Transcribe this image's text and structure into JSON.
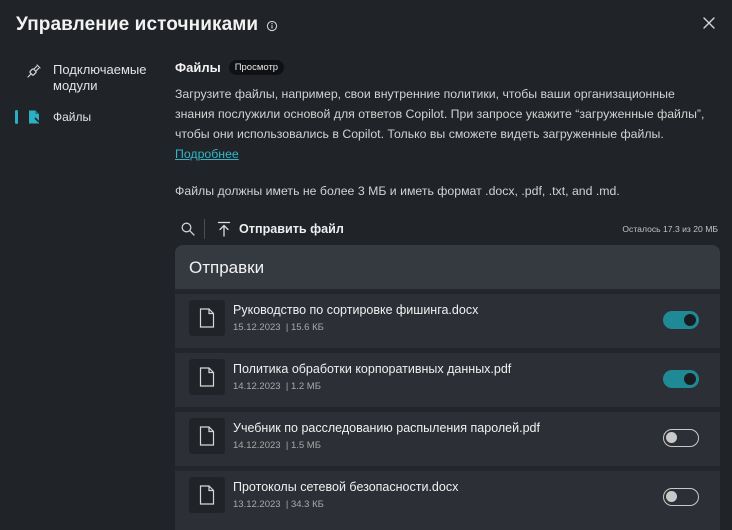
{
  "header": {
    "title": "Управление источниками"
  },
  "sidebar": {
    "items": [
      {
        "label": "Подключаемые модули",
        "icon": "plug-icon",
        "active": false
      },
      {
        "label": "Файлы",
        "icon": "file-icon",
        "active": true
      }
    ]
  },
  "files": {
    "title": "Файлы",
    "badge": "Просмотр",
    "description": "Загрузите файлы, например, свои внутренние политики, чтобы ваши организационные знания послужили основой для ответов Copilot. При запросе укажите “загруженные файлы”, чтобы они использовались в Copilot. Только вы сможете видеть загруженные файлы.",
    "learn_more": "Подробнее",
    "requirements": "Файлы должны иметь не более 3 МБ и иметь формат .docx, .pdf, .txt, and .md."
  },
  "toolbar": {
    "upload_label": "Отправить файл",
    "storage": "Осталось 17.3 из 20 МБ"
  },
  "uploads": {
    "title": "Отправки",
    "files": [
      {
        "name": "Руководство по сортировке фишинга.docx",
        "date": "15.12.2023",
        "size": "15.6 КБ",
        "enabled": true
      },
      {
        "name": "Политика обработки корпоративных данных.pdf",
        "date": "14.12.2023",
        "size": "1.2 МБ",
        "enabled": true
      },
      {
        "name": "Учебник по расследованию распыления паролей.pdf",
        "date": "14.12.2023",
        "size": "1.5 МБ",
        "enabled": false
      },
      {
        "name": "Протоколы сетевой безопасности.docx",
        "date": "13.12.2023",
        "size": "34.3 КБ",
        "enabled": false
      }
    ]
  },
  "colors": {
    "accent": "#2bb0c1",
    "toggle_on": "#1f8a96",
    "background": "#202328",
    "panel": "#2c3036"
  }
}
